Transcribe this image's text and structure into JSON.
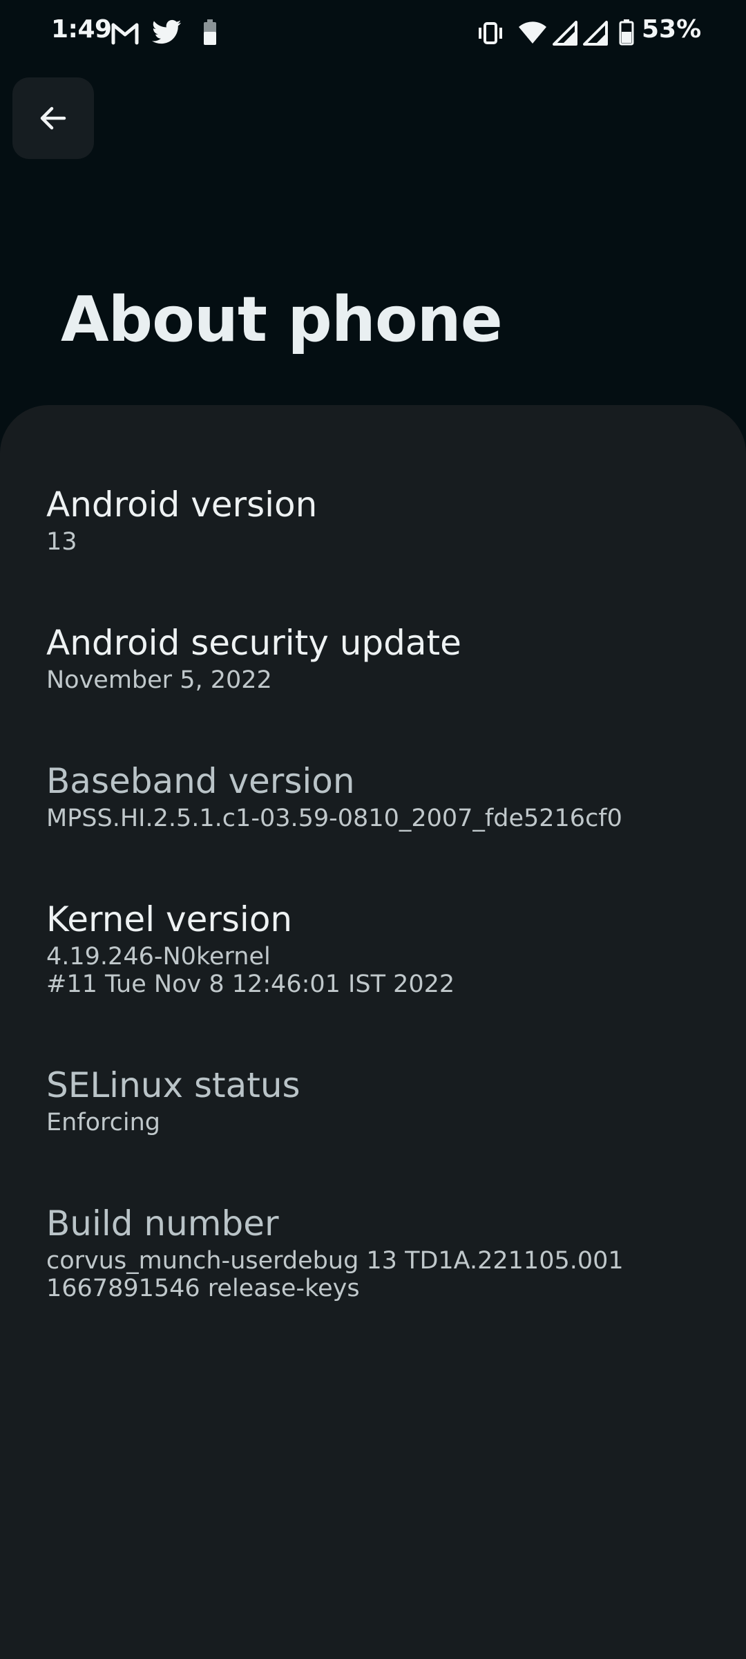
{
  "status_bar": {
    "time": "1:49",
    "battery_percent": "53%",
    "left_icons": [
      "gmail-icon",
      "twitter-icon",
      "battery-saver-icon"
    ],
    "right_icons": [
      "vibrate-icon",
      "wifi-icon",
      "signal-icon",
      "signal-icon",
      "battery-icon"
    ]
  },
  "header": {
    "back_icon": "arrow-left-icon",
    "title": "About phone"
  },
  "colors": {
    "background": "#040e12",
    "card": "#171c1f",
    "back_button_bg": "#161d21"
  },
  "items": [
    {
      "title": "Android version",
      "summary": "13"
    },
    {
      "title": "Android security update",
      "summary": "November 5, 2022"
    },
    {
      "title": "Baseband version",
      "summary": "MPSS.HI.2.5.1.c1-03.59-0810_2007_fde5216cf0"
    },
    {
      "title": "Kernel version",
      "summary": "4.19.246-N0kernel\n#11 Tue Nov 8 12:46:01 IST 2022"
    },
    {
      "title": "SELinux status",
      "summary": "Enforcing"
    },
    {
      "title": "Build number",
      "summary": "corvus_munch-userdebug 13 TD1A.221105.001\n1667891546 release-keys"
    }
  ]
}
